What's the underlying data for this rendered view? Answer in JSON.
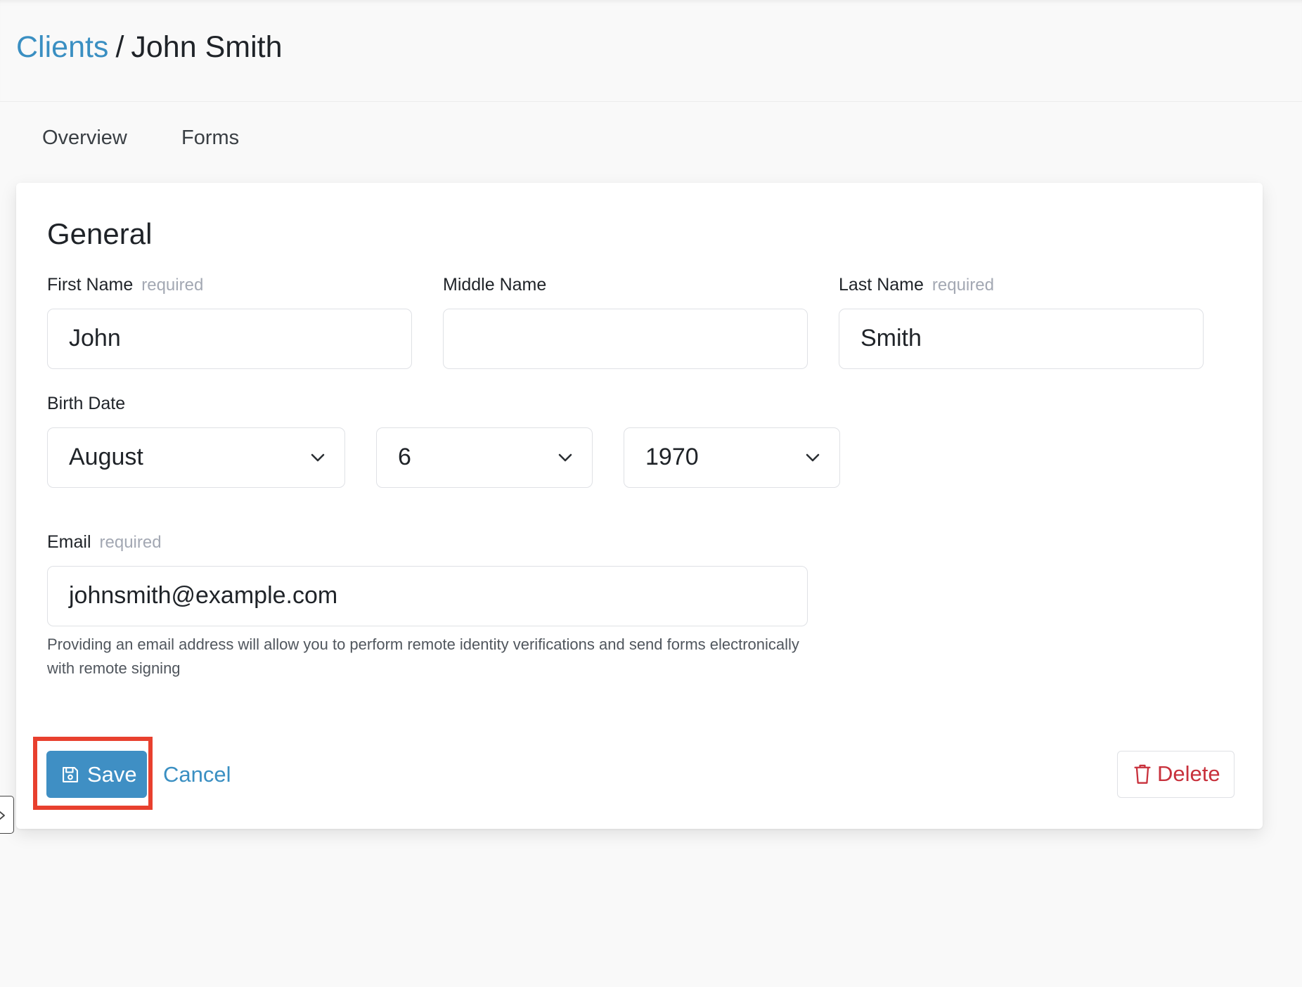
{
  "breadcrumb": {
    "parent": "Clients",
    "separator": "/",
    "current": "John Smith"
  },
  "tabs": [
    {
      "label": "Overview"
    },
    {
      "label": "Forms"
    }
  ],
  "general": {
    "title": "General",
    "required_text": "required",
    "first_name": {
      "label": "First Name",
      "value": "John"
    },
    "middle_name": {
      "label": "Middle Name",
      "value": ""
    },
    "last_name": {
      "label": "Last Name",
      "value": "Smith"
    },
    "birth_date": {
      "label": "Birth Date",
      "month": "August",
      "day": "6",
      "year": "1970"
    },
    "email": {
      "label": "Email",
      "value": "johnsmith@example.com",
      "helper": "Providing an email address will allow you to perform remote identity verifications and send forms electronically with remote signing"
    }
  },
  "actions": {
    "save_label": "Save",
    "cancel_label": "Cancel",
    "delete_label": "Delete"
  },
  "icons": {
    "save": "floppy-disk-icon",
    "delete": "trash-icon",
    "chevron": "chevron-down-icon",
    "side_handle": "chevron-right-icon"
  },
  "colors": {
    "link": "#3a8fc2",
    "primary_button": "#3f8fc4",
    "danger": "#c8313c",
    "required": "#a3a8b3",
    "highlight": "#e8402e"
  }
}
